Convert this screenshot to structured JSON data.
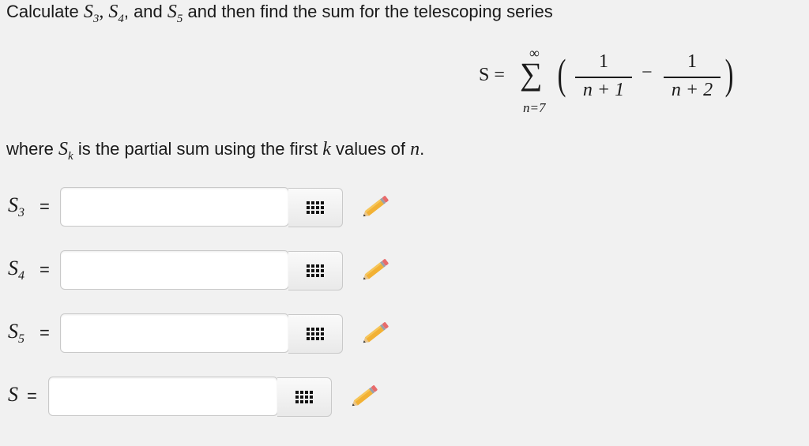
{
  "question": {
    "prefix": "Calculate ",
    "s": "S",
    "sub3": "3",
    "comma1": ", ",
    "sub4": "4",
    "comma2": ", and ",
    "sub5": "5",
    "suffix": " and then find the sum for the telescoping series"
  },
  "formula": {
    "lhs": "S =",
    "sigma": "∑",
    "upper": "∞",
    "lower": "n=7",
    "num1": "1",
    "den1": "n + 1",
    "minus": "−",
    "num2": "1",
    "den2": "n + 2",
    "lparen": "(",
    "rparen": ")"
  },
  "where": {
    "w1": "where ",
    "s": "S",
    "k": "k",
    "w2": " is the partial sum using the first ",
    "k2": "k",
    "w3": " values of ",
    "n": "n",
    "w4": "."
  },
  "answers": [
    {
      "label": "S",
      "sub": "3",
      "eq": "=",
      "value": ""
    },
    {
      "label": "S",
      "sub": "4",
      "eq": "=",
      "value": ""
    },
    {
      "label": "S",
      "sub": "5",
      "eq": "=",
      "value": ""
    },
    {
      "label": "S",
      "sub": "",
      "eq": "=",
      "value": ""
    }
  ],
  "icons": {
    "keypad": "keypad-icon",
    "pencil": "pencil-icon"
  }
}
